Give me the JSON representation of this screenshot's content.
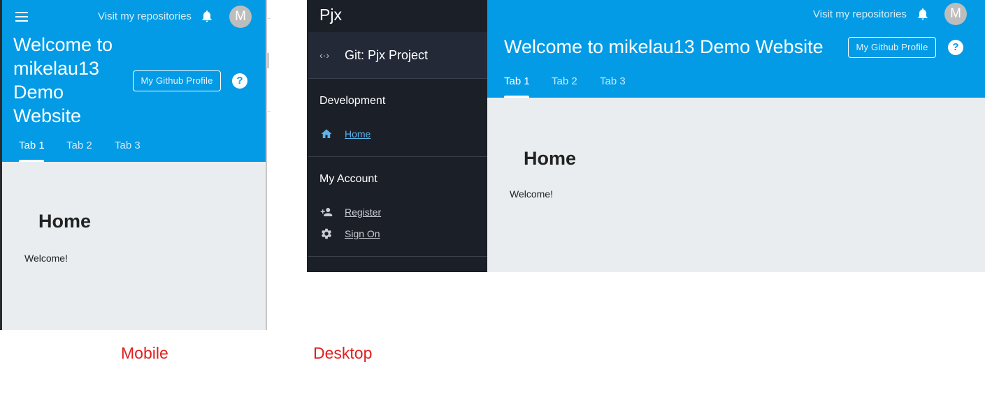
{
  "shared": {
    "brand": "Pjx",
    "visit_link": "Visit my repositories",
    "avatar_initial": "M",
    "github_button": "My Github Profile",
    "help_glyph": "?",
    "page_title": "Welcome to mikelau13 Demo Website",
    "tabs": [
      {
        "label": "Tab 1",
        "active": true
      },
      {
        "label": "Tab 2",
        "active": false
      },
      {
        "label": "Tab 3",
        "active": false
      }
    ],
    "content_heading": "Home",
    "content_text": "Welcome!"
  },
  "mobile": {
    "title_lines": [
      "Welcome to",
      "mikelau13",
      "Demo",
      "Website"
    ],
    "caption": "Mobile"
  },
  "desktop": {
    "sidebar": {
      "project_label": "Git: Pjx Project",
      "sections": [
        {
          "title": "Development",
          "items": [
            {
              "label": "Home",
              "icon": "home-icon"
            }
          ]
        },
        {
          "title": "My Account",
          "items": [
            {
              "label": "Register",
              "icon": "person-add-icon"
            },
            {
              "label": "Sign On",
              "icon": "gear-icon"
            }
          ]
        }
      ]
    },
    "caption": "Desktop"
  },
  "colors": {
    "header_blue": "#039be5",
    "sidebar_dark": "#1b1f27",
    "content_bg": "#e9edf0",
    "link_blue": "#5bb3ea",
    "caption_red": "#e0201d"
  }
}
